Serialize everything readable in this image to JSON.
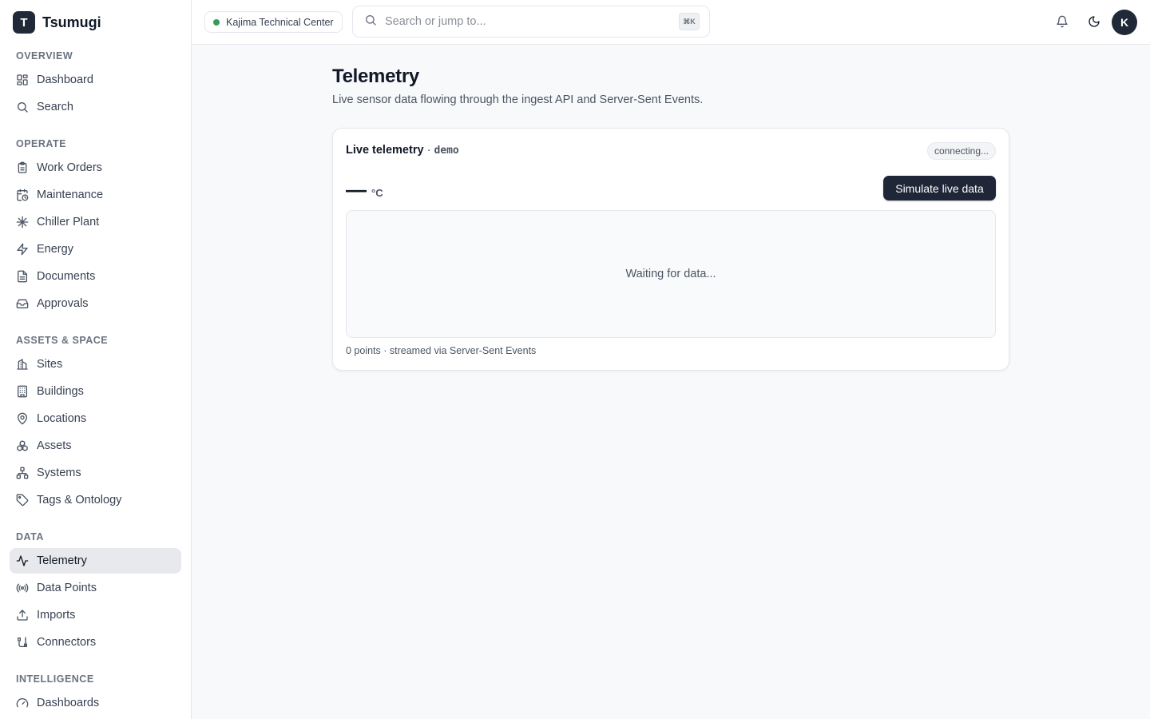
{
  "brand": {
    "logo_letter": "T",
    "name": "Tsumugi"
  },
  "sidebar": {
    "sections": [
      {
        "label": "OVERVIEW",
        "items": [
          {
            "label": "Dashboard",
            "icon": "dashboard-icon"
          },
          {
            "label": "Search",
            "icon": "search-icon"
          }
        ]
      },
      {
        "label": "OPERATE",
        "items": [
          {
            "label": "Work Orders",
            "icon": "clipboard-icon"
          },
          {
            "label": "Maintenance",
            "icon": "calendar-clock-icon"
          },
          {
            "label": "Chiller Plant",
            "icon": "snowflake-icon"
          },
          {
            "label": "Energy",
            "icon": "zap-icon"
          },
          {
            "label": "Documents",
            "icon": "file-text-icon"
          },
          {
            "label": "Approvals",
            "icon": "inbox-icon"
          }
        ]
      },
      {
        "label": "ASSETS & SPACE",
        "items": [
          {
            "label": "Sites",
            "icon": "building-icon"
          },
          {
            "label": "Buildings",
            "icon": "building2-icon"
          },
          {
            "label": "Locations",
            "icon": "map-pin-icon"
          },
          {
            "label": "Assets",
            "icon": "boxes-icon"
          },
          {
            "label": "Systems",
            "icon": "network-icon"
          },
          {
            "label": "Tags & Ontology",
            "icon": "tag-icon"
          }
        ]
      },
      {
        "label": "DATA",
        "items": [
          {
            "label": "Telemetry",
            "icon": "activity-icon",
            "active": true
          },
          {
            "label": "Data Points",
            "icon": "radio-icon"
          },
          {
            "label": "Imports",
            "icon": "upload-icon"
          },
          {
            "label": "Connectors",
            "icon": "cable-icon"
          }
        ]
      },
      {
        "label": "INTELLIGENCE",
        "items": [
          {
            "label": "Dashboards",
            "icon": "gauge-icon"
          }
        ]
      }
    ]
  },
  "header": {
    "site_name": "Kajima Technical Center",
    "site_status_color": "#3c9a5f",
    "search_placeholder": "Search or jump to...",
    "shortcut": "⌘K",
    "avatar_letter": "K"
  },
  "main": {
    "title": "Telemetry",
    "subtitle": "Live sensor data flowing through the ingest API and Server-Sent Events.",
    "card": {
      "title": "Live telemetry",
      "separator": "·",
      "source": "demo",
      "status": "connecting...",
      "reading_value": "—",
      "reading_unit": "°C",
      "simulate_label": "Simulate live data",
      "empty_text": "Waiting for data...",
      "footer": "0 points · streamed via Server-Sent Events"
    }
  },
  "colors": {
    "accent": "#1e2638",
    "active_bg": "#e8e9ec"
  }
}
